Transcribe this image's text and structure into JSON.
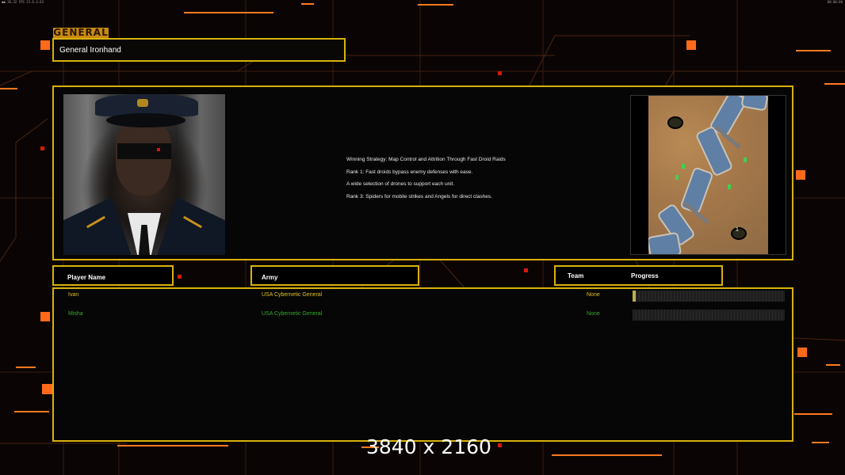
{
  "status_bar": {
    "left_text": "●● 36.32 FPS 23.6.4.63",
    "right_text": "00:00:00"
  },
  "general": {
    "section_label": "GENERAL",
    "name": "General Ironhand"
  },
  "briefing": {
    "lines": [
      "Winning Strategy: Map Control and Attrition Through Fast Droid Raids",
      "Rank 1: Fast droids bypass enemy defenses with ease.",
      "A wide selection of drones to support each unit.",
      "Rank 3: Spiders for mobile strikes and Angels for direct clashes."
    ],
    "minimap_marker": "1"
  },
  "table": {
    "headers": {
      "player_name": "Player Name",
      "army": "Army",
      "team": "Team",
      "progress": "Progress"
    },
    "rows": [
      {
        "player": "Ivan",
        "army": "USA Cybernetic General",
        "team": "None",
        "progress": 0.02,
        "color": "#e0c020"
      },
      {
        "player": "Misha",
        "army": "USA Cybernetic General",
        "team": "None",
        "progress": 0.0,
        "color": "#36a830"
      }
    ]
  },
  "overlay": {
    "resolution_text": "3840 x 2160"
  },
  "colors": {
    "frame_gold": "#d8b10d",
    "accent_orange": "#ff6a1a",
    "player_yellow": "#e0c020",
    "player_green": "#36a830"
  }
}
